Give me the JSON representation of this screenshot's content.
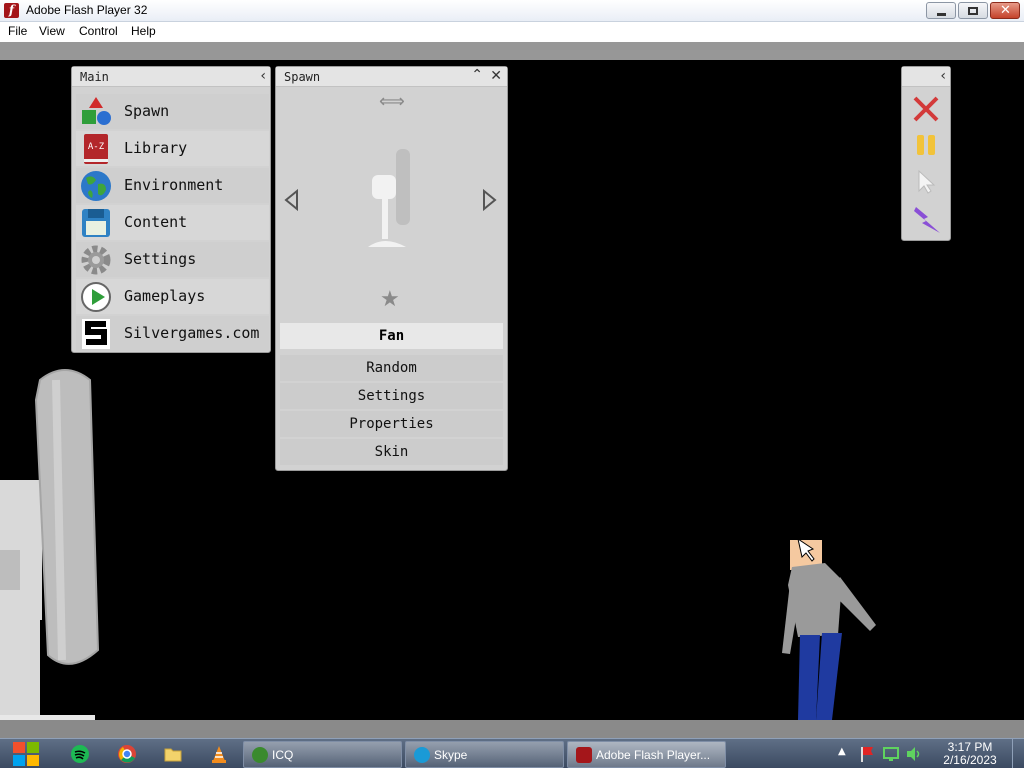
{
  "window": {
    "title": "Adobe Flash Player 32",
    "menu": [
      "File",
      "View",
      "Control",
      "Help"
    ]
  },
  "main_panel": {
    "title": "Main",
    "items": [
      {
        "label": "Spawn",
        "icon": "shapes-icon"
      },
      {
        "label": "Library",
        "icon": "library-book-icon",
        "badge": "A-Z"
      },
      {
        "label": "Environment",
        "icon": "globe-icon"
      },
      {
        "label": "Content",
        "icon": "floppy-disk-icon"
      },
      {
        "label": "Settings",
        "icon": "gear-icon"
      },
      {
        "label": "Gameplays",
        "icon": "play-icon"
      },
      {
        "label": "Silvergames.com",
        "icon": "silvergames-logo-icon"
      }
    ]
  },
  "spawn_panel": {
    "title": "Spawn",
    "selected": "Fan",
    "options": [
      "Random",
      "Settings",
      "Properties",
      "Skin"
    ]
  },
  "tools_panel": {
    "tools": [
      "delete-x-icon",
      "pause-icon",
      "cursor-icon",
      "lightning-icon"
    ]
  },
  "taskbar": {
    "tasks": [
      {
        "label": "ICQ",
        "color": "#3a8a2e"
      },
      {
        "label": "Skype",
        "color": "#1a9ad6"
      },
      {
        "label": "Adobe Flash Player...",
        "color": "#a4161a"
      }
    ],
    "clock": {
      "time": "3:17 PM",
      "date": "2/16/2023"
    }
  }
}
